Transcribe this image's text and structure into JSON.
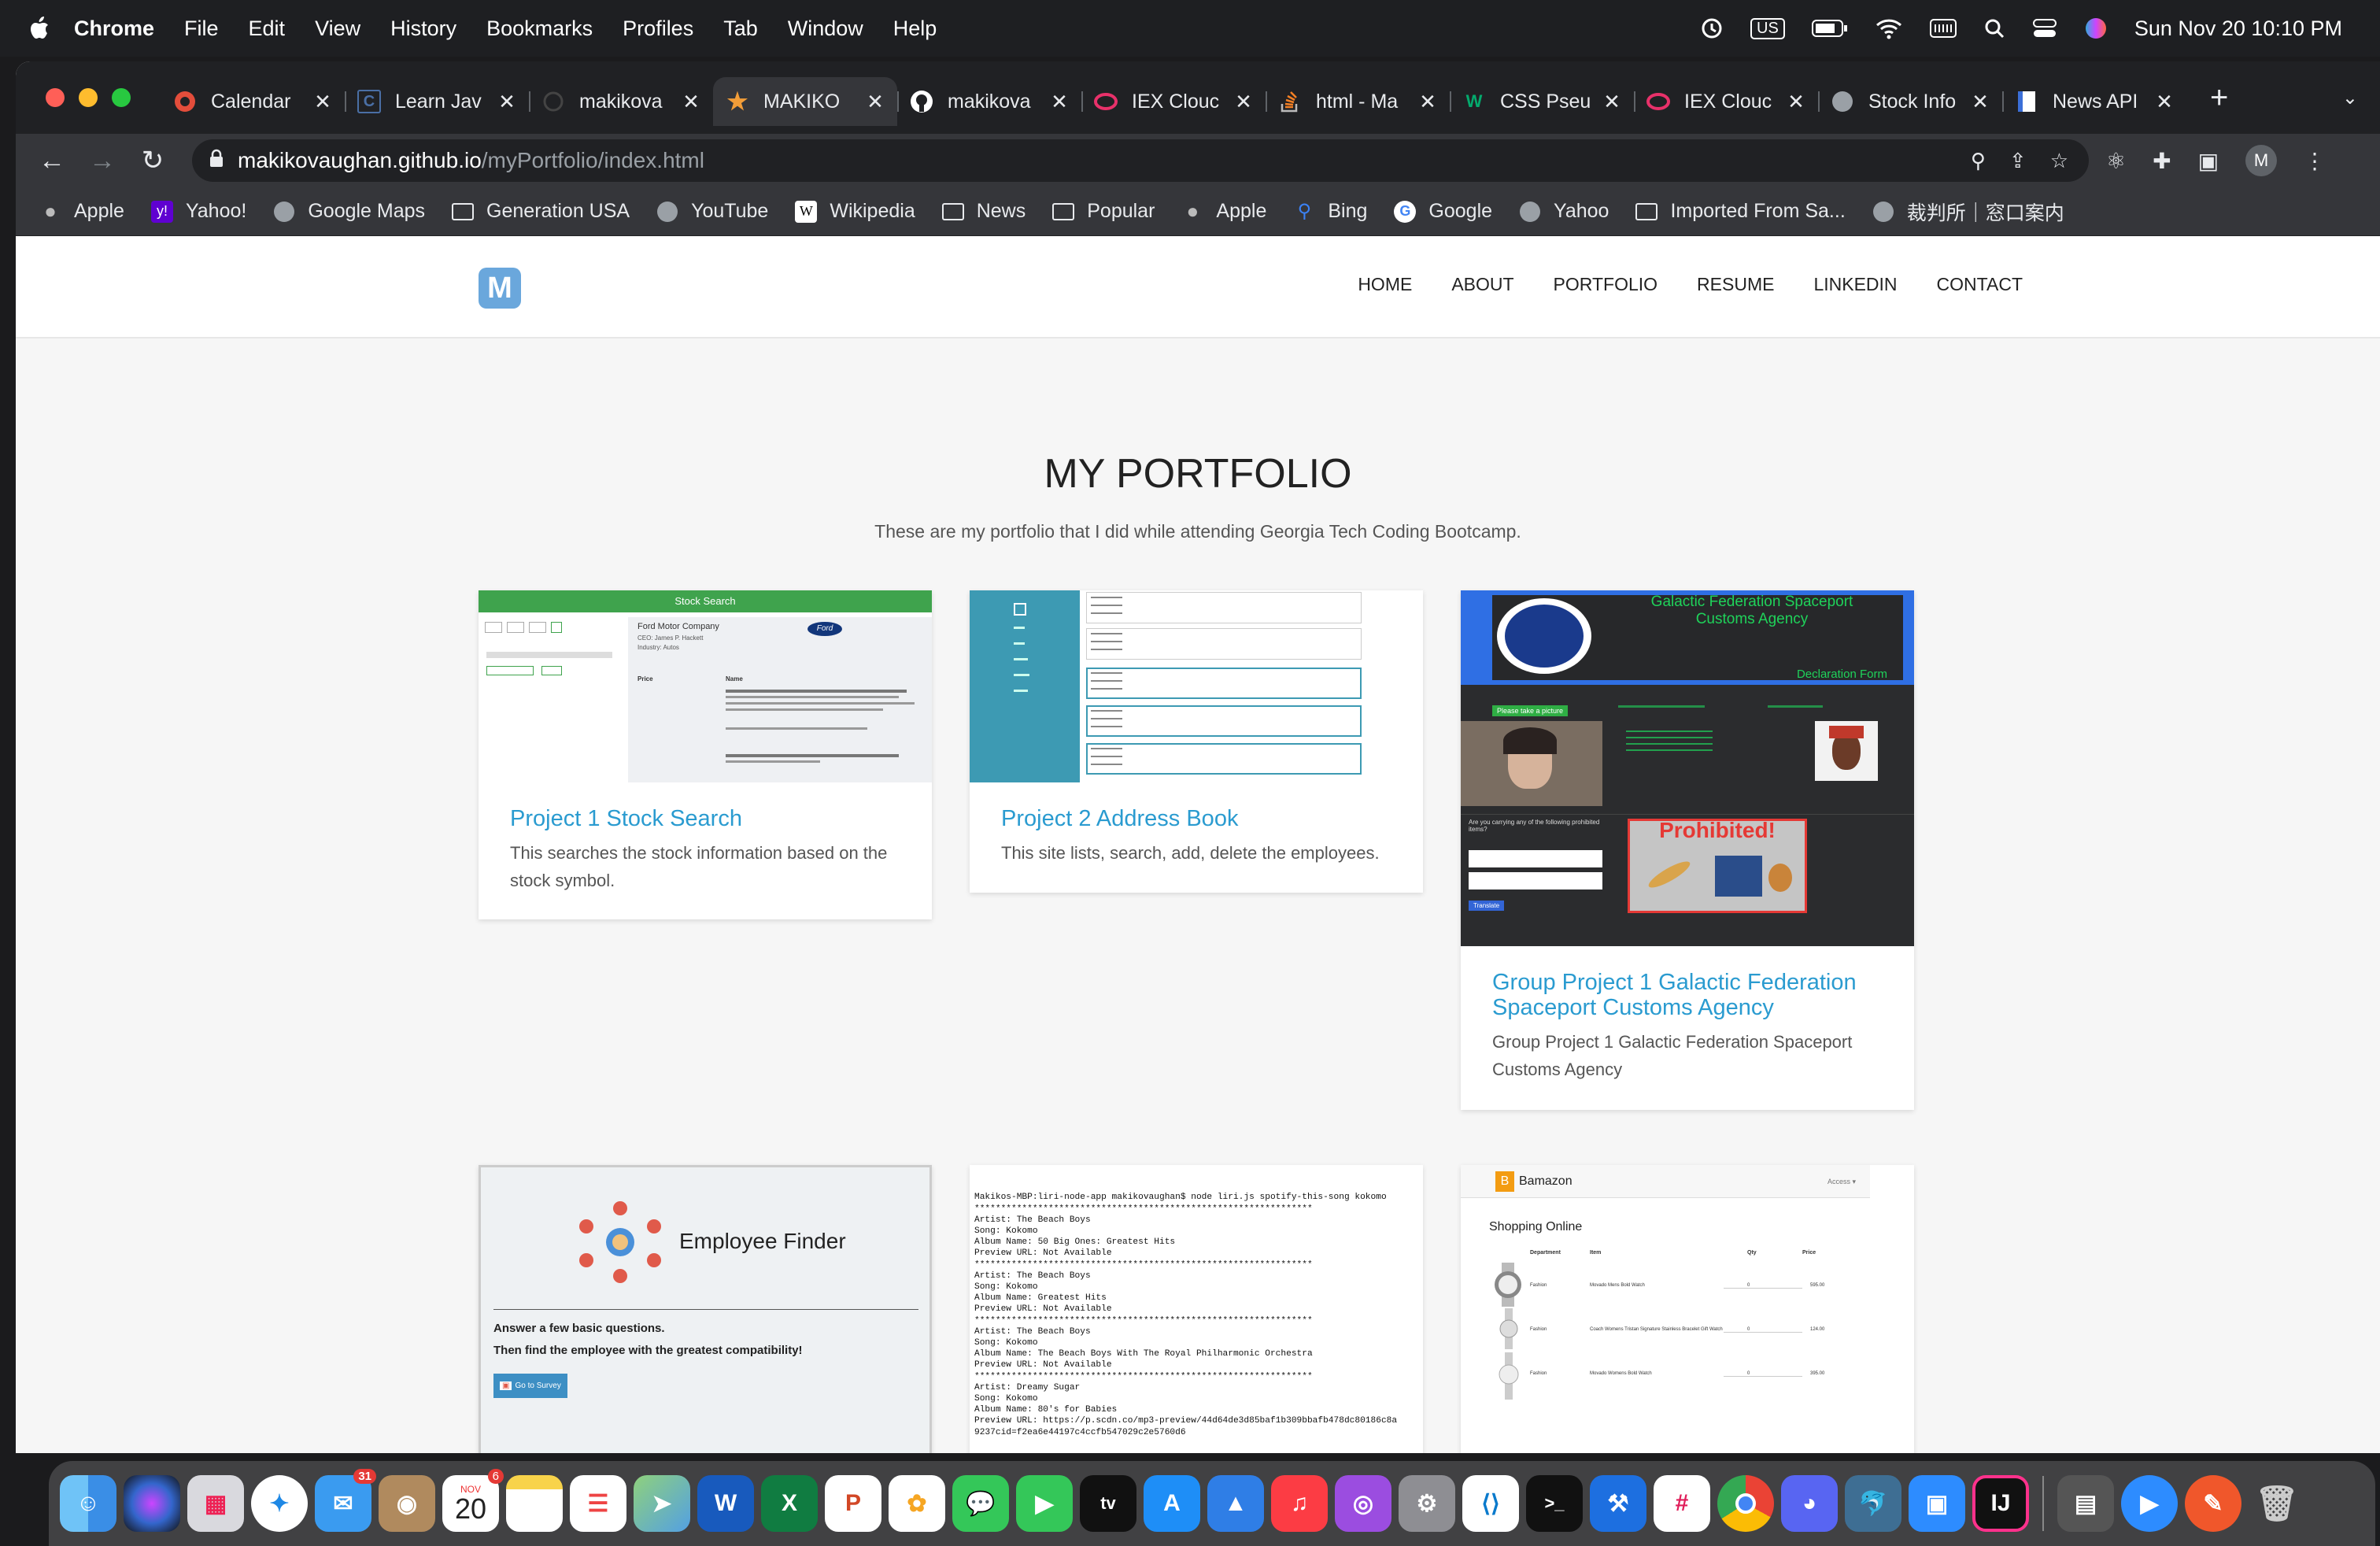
{
  "menubar": {
    "app": "Chrome",
    "menus": [
      "File",
      "Edit",
      "View",
      "History",
      "Bookmarks",
      "Profiles",
      "Tab",
      "Window",
      "Help"
    ],
    "input_source": "US",
    "datetime": "Sun Nov 20  10:10 PM"
  },
  "tabs": [
    {
      "title": "Calendar"
    },
    {
      "title": "Learn Jav"
    },
    {
      "title": "makikova"
    },
    {
      "title": "MAKIKO ",
      "active": true
    },
    {
      "title": "makikova"
    },
    {
      "title": "IEX Clouc"
    },
    {
      "title": "html - Ma"
    },
    {
      "title": "CSS Pseu"
    },
    {
      "title": "IEX Clouc"
    },
    {
      "title": "Stock Info"
    },
    {
      "title": "News API"
    }
  ],
  "address": {
    "host": "makikovaughan.github.io",
    "path": "/myPortfolio/index.html"
  },
  "profile_initial": "M",
  "bookmarks": [
    "Apple",
    "Yahoo!",
    "Google Maps",
    "Generation USA",
    "YouTube",
    "Wikipedia",
    "News",
    "Popular",
    "Apple",
    "Bing",
    "Google",
    "Yahoo",
    "Imported From Sa...",
    "裁判所｜窓口案内"
  ],
  "site": {
    "logo": "M",
    "nav": [
      "HOME",
      "ABOUT",
      "PORTFOLIO",
      "RESUME",
      "LINKEDIN",
      "CONTACT"
    ],
    "title": "MY PORTFOLIO",
    "subtitle": "These are my portfolio that I did while attending Georgia Tech Coding Bootcamp."
  },
  "projects": [
    {
      "title": "Project 1 Stock Search",
      "desc": "This searches the stock information based on the stock symbol."
    },
    {
      "title": "Project 2 Address Book",
      "desc": "This site lists, search, add, delete the employees."
    },
    {
      "title": "Group Project 1 Galactic Federation Spaceport Customs Agency",
      "desc": "Group Project 1 Galactic Federation Spaceport Customs Agency"
    }
  ],
  "thumbs": {
    "stock": {
      "banner": "Stock Search",
      "company": "Ford Motor Company",
      "ceo": "CEO: James P. Hackett",
      "industry": "Industry: Autos",
      "col_price": "Price",
      "col_name": "Name",
      "brand": "Ford"
    },
    "galactic": {
      "title1": "Galactic Federation Spaceport",
      "title2": "Customs Agency",
      "form": "Declaration Form",
      "take_picture": "Please take a picture",
      "question": "Are you carrying any of the following prohibited items?",
      "prohibited": "Prohibited!",
      "translate": "Translate"
    },
    "employee": {
      "title": "Employee Finder",
      "line1": "Answer a few basic questions.",
      "line2": "Then find the employee with the greatest compatibility!",
      "button": "Go to Survey"
    },
    "liri": {
      "lines": [
        "Makikos-MBP:liri-node-app makikovaughan$ node liri.js spotify-this-song kokomo",
        "****************************************************************",
        "Artist: The Beach Boys",
        "Song: Kokomo",
        "Album Name: 50 Big Ones: Greatest Hits",
        "Preview URL: Not Available",
        "****************************************************************",
        "Artist: The Beach Boys",
        "Song: Kokomo",
        "Album Name: Greatest Hits",
        "Preview URL: Not Available",
        "****************************************************************",
        "Artist: The Beach Boys",
        "Song: Kokomo",
        "Album Name: The Beach Boys With The Royal Philharmonic Orchestra",
        "Preview URL: Not Available",
        "****************************************************************",
        "Artist: Dreamy Sugar",
        "Song: Kokomo",
        "Album Name: 80's for Babies",
        "Preview URL: https://p.scdn.co/mp3-preview/44d64de3d85baf1b309bbafb478dc80186c8a",
        "9237cid=f2ea6e44197c4ccfb547029c2e5760d6"
      ]
    },
    "bamazon": {
      "brand": "Bamazon",
      "access": "Access ▾",
      "heading": "Shopping Online",
      "cols": [
        "Department",
        "Item",
        "Qty",
        "Price"
      ],
      "rows": [
        [
          "Fashion",
          "Movado Mens Bold Watch",
          "0",
          "595.00"
        ],
        [
          "Fashion",
          "Coach Womens Tristan Signature Stainless Bracelet Gift Watch",
          "0",
          "124.00"
        ],
        [
          "Fashion",
          "Movado Womens Bold Watch",
          "0",
          "395.00"
        ]
      ]
    }
  },
  "dock": {
    "calendar_month": "NOV",
    "calendar_day": "20",
    "calendar_badge": "6",
    "mail_badge": "31"
  }
}
